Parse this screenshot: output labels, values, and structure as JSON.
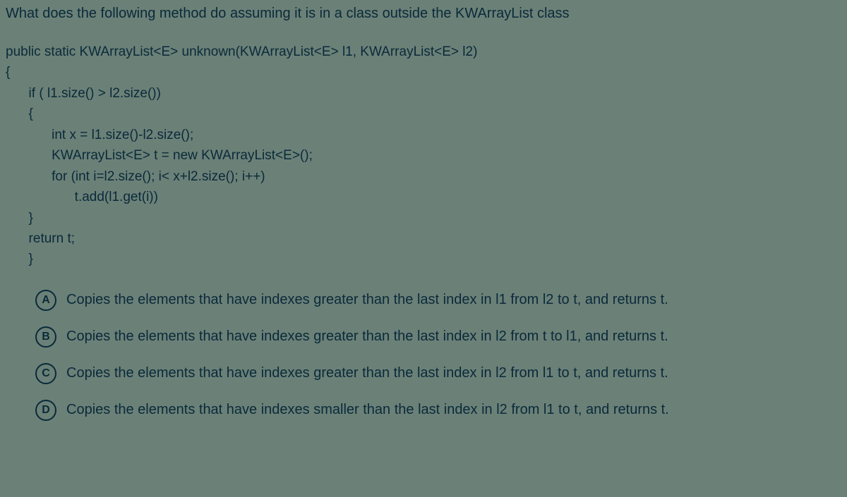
{
  "prompt": "What does the following method do assuming it is in a class outside the KWArrayList class",
  "code": [
    "public static KWArrayList<E> unknown(KWArrayList<E> l1, KWArrayList<E> l2)",
    "{",
    "  if ( l1.size() > l2.size())",
    "  {",
    "    int x = l1.size()-l2.size();",
    "    KWArrayList<E> t = new KWArrayList<E>();",
    "    for (int i=l2.size(); i< x+l2.size(); i++)",
    "      t.add(l1.get(i))",
    "  }",
    "  return t;",
    "  }"
  ],
  "options": [
    {
      "letter": "A",
      "text": "Copies the elements that have indexes greater than the last index in l1 from l2 to t, and returns t."
    },
    {
      "letter": "B",
      "text": "Copies the elements that have indexes greater than the last index in l2 from t to l1, and returns t."
    },
    {
      "letter": "C",
      "text": "Copies the elements that have indexes greater than the last index in l2 from l1 to t, and returns t."
    },
    {
      "letter": "D",
      "text": "Copies the elements that have indexes smaller than the last index in l2 from l1 to t, and returns t."
    }
  ]
}
